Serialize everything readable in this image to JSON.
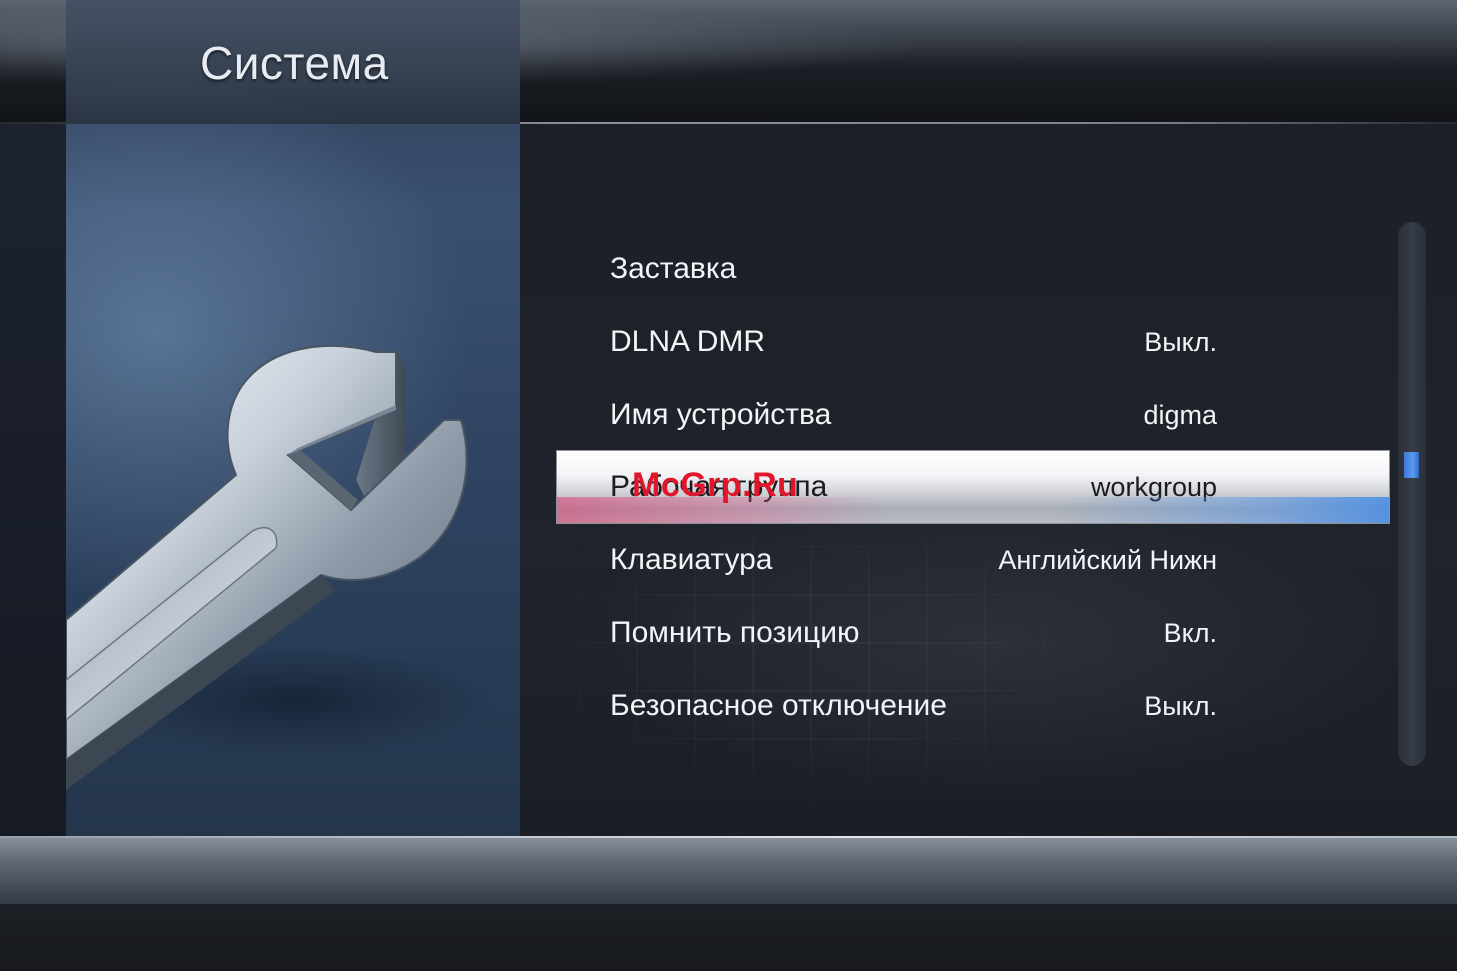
{
  "header": {
    "title": "Система"
  },
  "menu": {
    "items": [
      {
        "label": "Заставка",
        "value": ""
      },
      {
        "label": "DLNA DMR",
        "value": "Выкл."
      },
      {
        "label": "Имя устройства",
        "value": "digma"
      },
      {
        "label": "Рабочая группа",
        "value": "workgroup",
        "selected": true
      },
      {
        "label": "Клавиатура",
        "value": "Английский Нижн"
      },
      {
        "label": "Помнить позицию",
        "value": "Вкл."
      },
      {
        "label": "Безопасное отключение",
        "value": "Выкл."
      }
    ]
  },
  "watermark": {
    "text": "McGrp.Ru"
  },
  "illustration": {
    "icon": "wrench-icon"
  },
  "colors": {
    "accent": "#4a8ae6",
    "selection_highlight": "#ffffff",
    "watermark": "#e0162b",
    "text": "#f2f4f7"
  }
}
